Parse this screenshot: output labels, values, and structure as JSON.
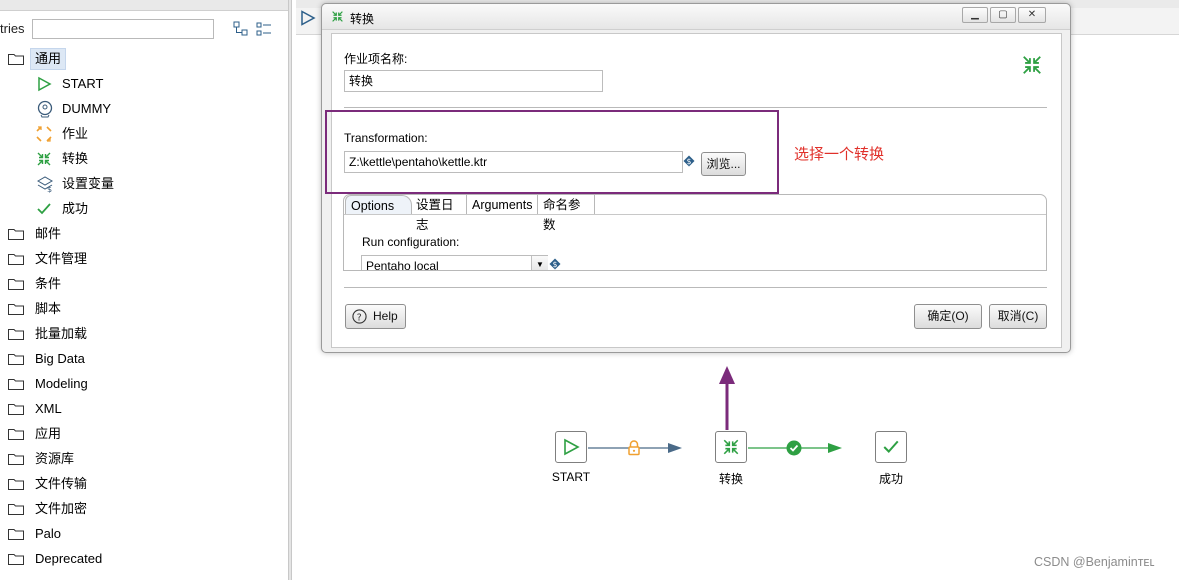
{
  "left_panel": {
    "filter_label": "tries",
    "categories": [
      {
        "label": "通用",
        "selected": true,
        "children": [
          {
            "label": "START",
            "icon": "start-triangle-icon"
          },
          {
            "label": "DUMMY",
            "icon": "dummy-head-icon"
          },
          {
            "label": "作业",
            "icon": "job-icon"
          },
          {
            "label": "转换",
            "icon": "transformation-icon"
          },
          {
            "label": "设置变量",
            "icon": "set-variable-icon"
          },
          {
            "label": "成功",
            "icon": "success-check-icon"
          }
        ]
      },
      {
        "label": "邮件"
      },
      {
        "label": "文件管理"
      },
      {
        "label": "条件"
      },
      {
        "label": "脚本"
      },
      {
        "label": "批量加载"
      },
      {
        "label": "Big Data"
      },
      {
        "label": "Modeling"
      },
      {
        "label": "XML"
      },
      {
        "label": "应用"
      },
      {
        "label": "资源库"
      },
      {
        "label": "文件传输"
      },
      {
        "label": "文件加密"
      },
      {
        "label": "Palo"
      },
      {
        "label": "Deprecated"
      }
    ]
  },
  "dialog": {
    "title": "转换",
    "job_entry_name_label": "作业项名称:",
    "job_entry_name_value": "转换",
    "transformation_label": "Transformation:",
    "transformation_path": "Z:\\kettle\\pentaho\\kettle.ktr",
    "browse_button": "浏览...",
    "tabs": [
      "Options",
      "设置日志",
      "Arguments",
      "命名参数"
    ],
    "active_tab": "Options",
    "run_configuration_label": "Run configuration:",
    "run_configuration_value": "Pentaho local",
    "help_button": "Help",
    "ok_button": "确定(O)",
    "cancel_button": "取消(C)"
  },
  "annotation": "选择一个转换",
  "flow": {
    "nodes": [
      {
        "label": "START",
        "icon": "start-triangle-icon"
      },
      {
        "label": "转换",
        "icon": "transformation-icon"
      },
      {
        "label": "成功",
        "icon": "success-check-icon"
      }
    ]
  },
  "colors": {
    "accent_green": "#2ea043",
    "highlight_purple": "#7b2b7b",
    "annotation_red": "#e0302a",
    "hop_blue": "#4a6a88"
  },
  "watermark": "CSDN @Benjaminᴛᴇʟ"
}
